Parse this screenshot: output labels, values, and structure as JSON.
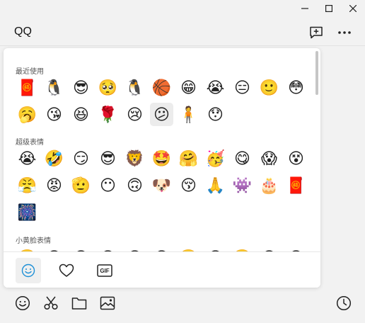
{
  "window": {
    "title": "QQ",
    "controls": [
      "minimize",
      "maximize",
      "close"
    ]
  },
  "header": {
    "icons": [
      "new-message-icon",
      "more-icon"
    ]
  },
  "emoji_panel": {
    "sections": [
      {
        "title": "最近使用",
        "items": [
          {
            "name": "red-envelope",
            "glyph": "🧧"
          },
          {
            "name": "couple-penguins",
            "glyph": "🐧"
          },
          {
            "name": "cool-smirk",
            "glyph": "😎"
          },
          {
            "name": "pleading-hands",
            "glyph": "🥺"
          },
          {
            "name": "qq-penguin",
            "glyph": "🐧"
          },
          {
            "name": "basketball",
            "glyph": "🏀"
          },
          {
            "name": "grinning-teeth",
            "glyph": "😁"
          },
          {
            "name": "crying-loud",
            "glyph": "😭"
          },
          {
            "name": "sleepy-face",
            "glyph": "😑"
          },
          {
            "name": "smiling-face",
            "glyph": "🙂"
          },
          {
            "name": "surprised-face",
            "glyph": "😳"
          },
          {
            "name": "yawning-face",
            "glyph": "🥱"
          },
          {
            "name": "kissing-face",
            "glyph": "😘"
          },
          {
            "name": "laughing-face",
            "glyph": "😆"
          },
          {
            "name": "rose",
            "glyph": "🌹"
          },
          {
            "name": "tearful-face",
            "glyph": "😢"
          },
          {
            "name": "awkward-face",
            "glyph": "😕"
          },
          {
            "name": "green-body",
            "glyph": "🧍"
          },
          {
            "name": "shocked-face",
            "glyph": "😯"
          }
        ]
      },
      {
        "title": "超级表情",
        "items": [
          {
            "name": "crying-loud",
            "glyph": "😭"
          },
          {
            "name": "rolling-laugh",
            "glyph": "🤣"
          },
          {
            "name": "smirk-face",
            "glyph": "😏"
          },
          {
            "name": "sunglasses-face",
            "glyph": "😎"
          },
          {
            "name": "lion-face",
            "glyph": "🦁"
          },
          {
            "name": "star-eyes",
            "glyph": "🤩"
          },
          {
            "name": "hug-face",
            "glyph": "🤗"
          },
          {
            "name": "party-face",
            "glyph": "🥳"
          },
          {
            "name": "lollipop-face",
            "glyph": "😋"
          },
          {
            "name": "scream-face",
            "glyph": "😱"
          },
          {
            "name": "dizzy-face",
            "glyph": "😵"
          },
          {
            "name": "pout-face",
            "glyph": "😤"
          },
          {
            "name": "red-face",
            "glyph": "😡"
          },
          {
            "name": "salute-face",
            "glyph": "🫡"
          },
          {
            "name": "afro-face",
            "glyph": "😶"
          },
          {
            "name": "block-face",
            "glyph": "🙃"
          },
          {
            "name": "doge-face",
            "glyph": "🐶"
          },
          {
            "name": "kiss-heart",
            "glyph": "😚"
          },
          {
            "name": "bow-hands",
            "glyph": "🙏"
          },
          {
            "name": "fighter",
            "glyph": "👾"
          },
          {
            "name": "cake",
            "glyph": "🎂"
          },
          {
            "name": "red-envelope",
            "glyph": "🧧"
          },
          {
            "name": "fireworks",
            "glyph": "🎆"
          }
        ]
      },
      {
        "title": "小黄脸表情",
        "items": [
          {
            "name": "face-1",
            "glyph": "🙂"
          },
          {
            "name": "face-2",
            "glyph": "😊"
          },
          {
            "name": "face-3",
            "glyph": "😀"
          },
          {
            "name": "face-4",
            "glyph": "😄"
          },
          {
            "name": "face-5",
            "glyph": "😃"
          },
          {
            "name": "face-6",
            "glyph": "😉"
          },
          {
            "name": "face-7",
            "glyph": "🙂"
          },
          {
            "name": "face-8",
            "glyph": "😊"
          },
          {
            "name": "face-9",
            "glyph": "🙂"
          },
          {
            "name": "face-10",
            "glyph": "😡"
          },
          {
            "name": "face-11",
            "glyph": "😠"
          }
        ]
      }
    ],
    "tabs": [
      {
        "name": "emoji-tab",
        "icon": "smile-icon",
        "active": true
      },
      {
        "name": "favorites-tab",
        "icon": "heart-icon",
        "active": false
      },
      {
        "name": "gif-tab",
        "icon": "gif-icon",
        "label": "GIF",
        "active": false
      }
    ]
  },
  "toolbar": {
    "icons": [
      "emoji-icon",
      "scissors-icon",
      "folder-icon",
      "image-icon",
      "history-icon"
    ]
  },
  "colors": {
    "background": "#f2f2f2",
    "panel": "#ffffff",
    "icon": "#222222"
  }
}
